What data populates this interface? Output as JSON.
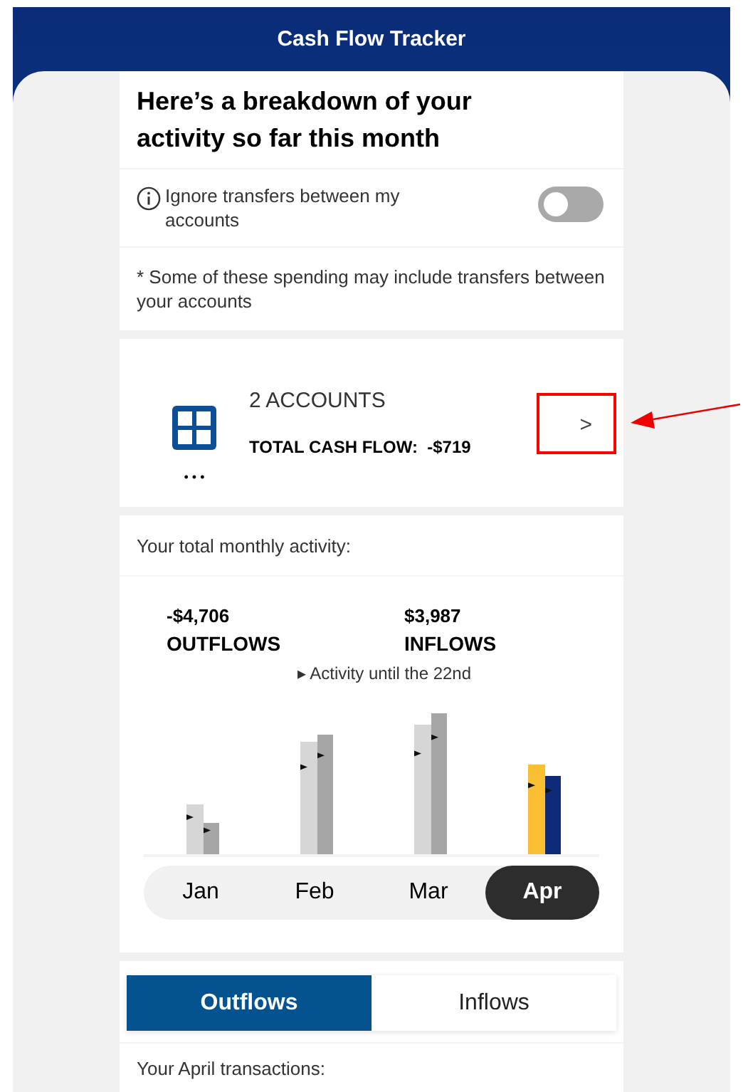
{
  "header": {
    "title": "Cash Flow Tracker"
  },
  "summary": {
    "heading": "Here’s a breakdown of your activity so far this month",
    "toggle": {
      "label": "Ignore transfers between my accounts",
      "on": false
    },
    "note": "* Some of these spending may include transfers between your accounts"
  },
  "accounts": {
    "count": "2 ACCOUNTS",
    "total_label": "TOTAL CASH FLOW:",
    "total_value": "-$719",
    "more": "• • •",
    "open": ">"
  },
  "activity": {
    "title": "Your total monthly activity:",
    "outflows": {
      "amount": "-$4,706",
      "label": "OUTFLOWS"
    },
    "inflows": {
      "amount": "$3,987",
      "label": "INFLOWS"
    },
    "legend": "▸ Activity until the 22nd",
    "months": [
      {
        "label": "Jan",
        "selected": false
      },
      {
        "label": "Feb",
        "selected": false
      },
      {
        "label": "Mar",
        "selected": false
      },
      {
        "label": "Apr",
        "selected": true
      }
    ]
  },
  "transactions": {
    "tabs": [
      {
        "label": "Outflows",
        "selected": true
      },
      {
        "label": "Inflows",
        "selected": false
      }
    ],
    "title": "Your April transactions:"
  }
}
